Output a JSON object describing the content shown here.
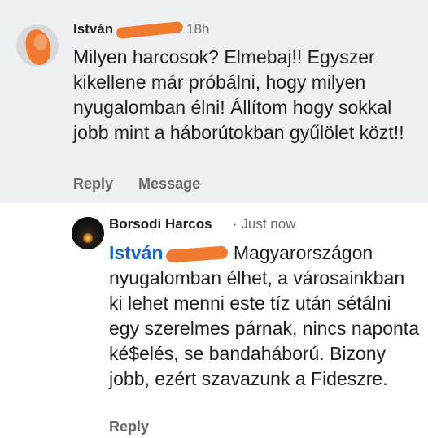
{
  "comment1": {
    "author_first": "István",
    "time": "18h",
    "text": "Milyen harcosok? Elmebaj!! Egyszer kikellene már próbálni, hogy milyen nyugalomban élni! Állítom hogy sokkal jobb mint a háborútokban gyűlölet közt!!",
    "reply_label": "Reply",
    "message_label": "Message"
  },
  "comment2": {
    "author": "Borsodi Harcos",
    "time": "· Just now",
    "mention_first": "István",
    "text": "Magyarországon nyugalomban élhet, a városainkban ki lehet menni este tíz után sétálni egy szerelmes párnak, nincs naponta ké$elés, se bandaháború. Bizony jobb, ezért szavazunk a Fideszre.",
    "reply_label": "Reply"
  }
}
